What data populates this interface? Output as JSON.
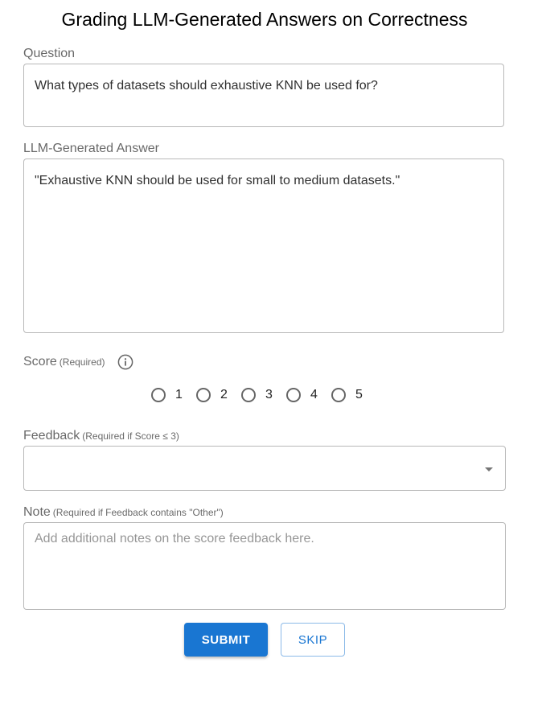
{
  "page": {
    "title": "Grading LLM-Generated Answers on Correctness"
  },
  "question": {
    "label": "Question",
    "value": "What types of datasets should exhaustive KNN be used for?"
  },
  "answer": {
    "label": "LLM-Generated Answer",
    "value": "\"Exhaustive KNN should be used for small to medium datasets.\""
  },
  "score": {
    "label": "Score",
    "hint": "(Required)",
    "info_icon": "info-circle-icon",
    "options": [
      "1",
      "2",
      "3",
      "4",
      "5"
    ],
    "selected": null
  },
  "feedback": {
    "label": "Feedback",
    "hint": "(Required if Score ≤ 3)",
    "value": "",
    "dropdown_icon": "caret-down-icon"
  },
  "note": {
    "label": "Note",
    "hint": "(Required if Feedback contains \"Other\")",
    "placeholder": "Add additional notes on the score feedback here.",
    "value": ""
  },
  "actions": {
    "submit_label": "SUBMIT",
    "skip_label": "SKIP"
  },
  "colors": {
    "primary": "#1976d2",
    "border": "#c4c4c4",
    "label": "#666666"
  }
}
